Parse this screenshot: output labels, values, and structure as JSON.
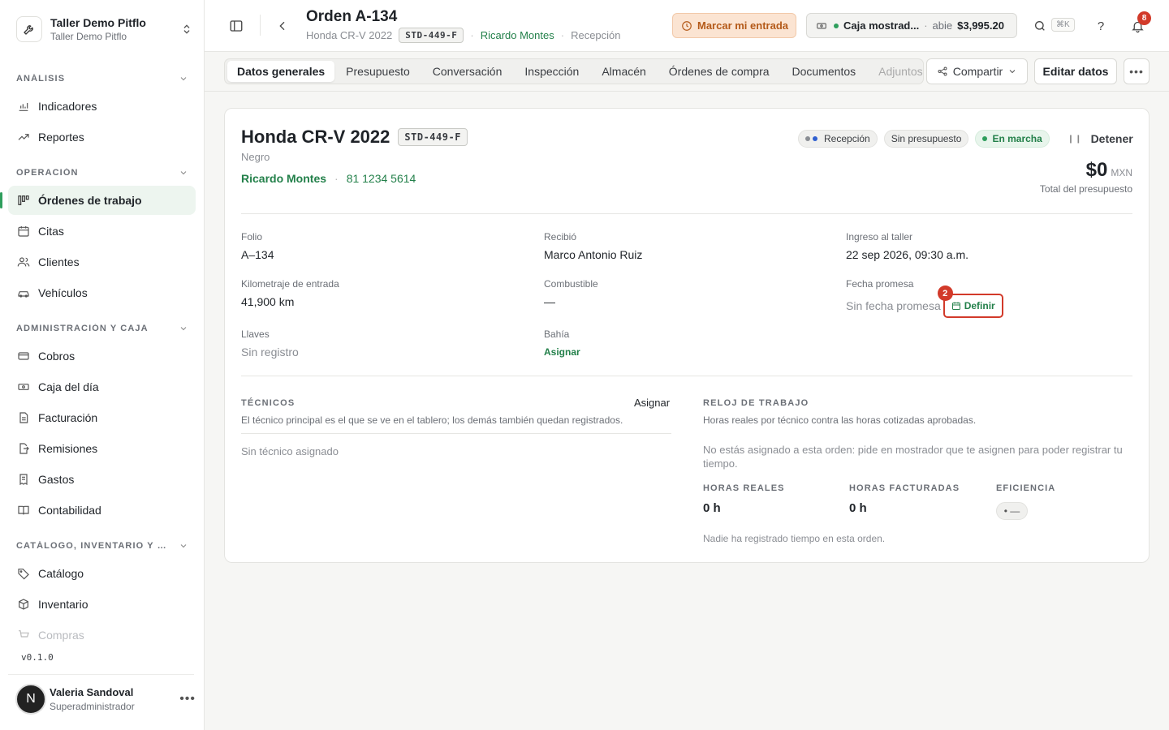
{
  "workspace": {
    "name": "Taller Demo Pitflo",
    "sub": "Taller Demo Pitflo"
  },
  "sidebar": {
    "sections": [
      {
        "label": "ANÁLISIS",
        "items": [
          "Indicadores",
          "Reportes"
        ]
      },
      {
        "label": "OPERACIÓN",
        "items": [
          "Órdenes de trabajo",
          "Citas",
          "Clientes",
          "Vehículos"
        ]
      },
      {
        "label": "ADMINISTRACIÓN Y CAJA",
        "items": [
          "Cobros",
          "Caja del día",
          "Facturación",
          "Remisiones",
          "Gastos",
          "Contabilidad"
        ]
      },
      {
        "label": "CATÁLOGO, INVENTARIO Y COMPRAS",
        "items": [
          "Catálogo",
          "Inventario",
          "Compras"
        ]
      }
    ],
    "active_item": "Órdenes de trabajo",
    "version": "v0.1.0"
  },
  "user": {
    "initial": "N",
    "name": "Valeria Sandoval",
    "role": "Superadministrador"
  },
  "header": {
    "title": "Orden A-134",
    "vehicle": "Honda CR-V 2022",
    "plate": "STD-449-F",
    "customer": "Ricardo Montes",
    "stage": "Recepción",
    "mark_entry": "Marcar mi entrada",
    "register": {
      "name": "Caja mostrad...",
      "status": "abie",
      "amount": "$3,995.20"
    },
    "shortcut": "⌘K",
    "help": "?",
    "notifications": "8"
  },
  "tabs": [
    "Datos generales",
    "Presupuesto",
    "Conversación",
    "Inspección",
    "Almacén",
    "Órdenes de compra",
    "Documentos",
    "Adjuntos"
  ],
  "active_tab": "Datos generales",
  "actions": {
    "share": "Compartir",
    "edit": "Editar datos",
    "more": "•••"
  },
  "vehicle_card": {
    "title": "Honda CR-V 2022",
    "plate": "STD-449-F",
    "color": "Negro",
    "owner": "Ricardo Montes",
    "phone": "81 1234 5614",
    "status_pills": {
      "stage": "Recepción",
      "budget": "Sin presupuesto",
      "running": "En marcha"
    },
    "stop": "Detener",
    "total": {
      "amount": "$0",
      "currency": "MXN",
      "label": "Total del presupuesto"
    }
  },
  "fields": {
    "folio": {
      "label": "Folio",
      "value": "A–134"
    },
    "received_by": {
      "label": "Recibió",
      "value": "Marco Antonio Ruiz"
    },
    "entry": {
      "label": "Ingreso al taller",
      "value": "22 sep 2026, 09:30 a.m."
    },
    "mileage": {
      "label": "Kilometraje de entrada",
      "value": "41,900 km"
    },
    "fuel": {
      "label": "Combustible",
      "value": "—"
    },
    "promise": {
      "label": "Fecha promesa",
      "value": "Sin fecha promesa",
      "action": "Definir",
      "step": "2"
    },
    "keys": {
      "label": "Llaves",
      "value": "Sin registro"
    },
    "bay": {
      "label": "Bahía",
      "action": "Asignar"
    }
  },
  "technicians": {
    "title": "TÉCNICOS",
    "assign": "Asignar",
    "description": "El técnico principal es el que se ve en el tablero; los demás también quedan registrados.",
    "empty": "Sin técnico asignado"
  },
  "clock": {
    "title": "RELOJ DE TRABAJO",
    "description": "Horas reales por técnico contra las horas cotizadas aprobadas.",
    "notice": "No estás asignado a esta orden: pide en mostrador que te asignen para poder registrar tu tiempo.",
    "real_label": "HORAS REALES",
    "real_value": "0 h",
    "billed_label": "HORAS FACTURADAS",
    "billed_value": "0 h",
    "eff_label": "EFICIENCIA",
    "eff_value": "• —",
    "empty": "Nadie ha registrado tiempo en esta orden."
  },
  "colors": {
    "accent_green": "#23804a",
    "warning_bg": "#fbe4d2",
    "alert_red": "#d23a2a"
  }
}
